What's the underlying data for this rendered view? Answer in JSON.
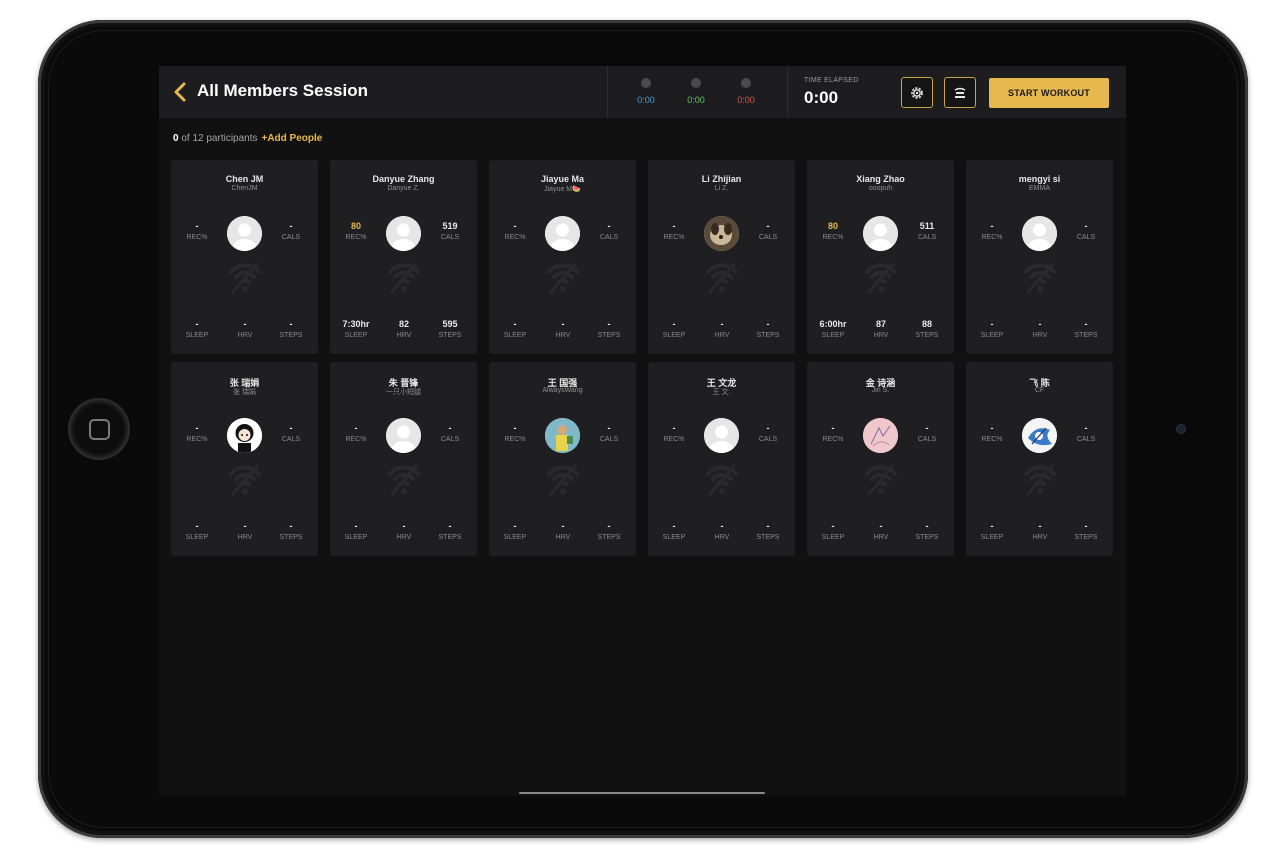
{
  "header": {
    "title": "All Members Session",
    "timers": [
      {
        "value": "0:00",
        "color": "#4a9fd8"
      },
      {
        "value": "0:00",
        "color": "#5cc46a"
      },
      {
        "value": "0:00",
        "color": "#d85050"
      }
    ],
    "elapsed_label": "TIME ELAPSED",
    "elapsed_value": "0:00",
    "start_label": "START WORKOUT"
  },
  "participants": {
    "count": "0",
    "total_text": " of 12 participants",
    "add_label": "+Add People"
  },
  "labels": {
    "rec": "REC%",
    "cals": "CALS",
    "sleep": "SLEEP",
    "hrv": "HRV",
    "steps": "STEPS"
  },
  "cards": [
    {
      "name": "Chen JM",
      "sub": "ChenJM",
      "rec": "-",
      "cals": "-",
      "sleep": "-",
      "hrv": "-",
      "steps": "-",
      "rec_accent": false,
      "avatar": "default-avatar"
    },
    {
      "name": "Danyue Zhang",
      "sub": "Danyue Z.",
      "rec": "80",
      "cals": "519",
      "sleep": "7:30hr",
      "hrv": "82",
      "steps": "595",
      "rec_accent": true,
      "avatar": "default-avatar"
    },
    {
      "name": "Jiayue Ma",
      "sub": "Jiayue M🍉",
      "rec": "-",
      "cals": "-",
      "sleep": "-",
      "hrv": "-",
      "steps": "-",
      "rec_accent": false,
      "avatar": "default-avatar"
    },
    {
      "name": "Li Zhijian",
      "sub": "Li Z.",
      "rec": "-",
      "cals": "-",
      "sleep": "-",
      "hrv": "-",
      "steps": "-",
      "rec_accent": false,
      "avatar": "photo-avatar-dog"
    },
    {
      "name": "Xiang Zhao",
      "sub": "ooopuh",
      "rec": "80",
      "cals": "511",
      "sleep": "6:00hr",
      "hrv": "87",
      "steps": "88",
      "rec_accent": true,
      "avatar": "default-avatar"
    },
    {
      "name": "mengyi si",
      "sub": "EMMA",
      "rec": "-",
      "cals": "-",
      "sleep": "-",
      "hrv": "-",
      "steps": "-",
      "rec_accent": false,
      "avatar": "default-avatar"
    },
    {
      "name": "张 瑞娟",
      "sub": "张 瑞娟",
      "rec": "-",
      "cals": "-",
      "sleep": "-",
      "hrv": "-",
      "steps": "-",
      "rec_accent": false,
      "avatar": "cartoon-avatar"
    },
    {
      "name": "朱 晋锋",
      "sub": "一只小短腿",
      "rec": "-",
      "cals": "-",
      "sleep": "-",
      "hrv": "-",
      "steps": "-",
      "rec_accent": false,
      "avatar": "default-avatar"
    },
    {
      "name": "王 国强",
      "sub": "AlwaysWang",
      "rec": "-",
      "cals": "-",
      "sleep": "-",
      "hrv": "-",
      "steps": "-",
      "rec_accent": false,
      "avatar": "photo-avatar-person"
    },
    {
      "name": "王 文龙",
      "sub": "王 文.",
      "rec": "-",
      "cals": "-",
      "sleep": "-",
      "hrv": "-",
      "steps": "-",
      "rec_accent": false,
      "avatar": "default-avatar"
    },
    {
      "name": "金 诗涵",
      "sub": "Jin S.",
      "rec": "-",
      "cals": "-",
      "sleep": "-",
      "hrv": "-",
      "steps": "-",
      "rec_accent": false,
      "avatar": "sketch-avatar"
    },
    {
      "name": "飞 陈",
      "sub": "CF",
      "rec": "-",
      "cals": "-",
      "sleep": "-",
      "hrv": "-",
      "steps": "-",
      "rec_accent": false,
      "avatar": "blue-art-avatar"
    }
  ],
  "colors": {
    "accent": "#e6b84e",
    "background": "#111111",
    "card": "#1f1f21"
  }
}
